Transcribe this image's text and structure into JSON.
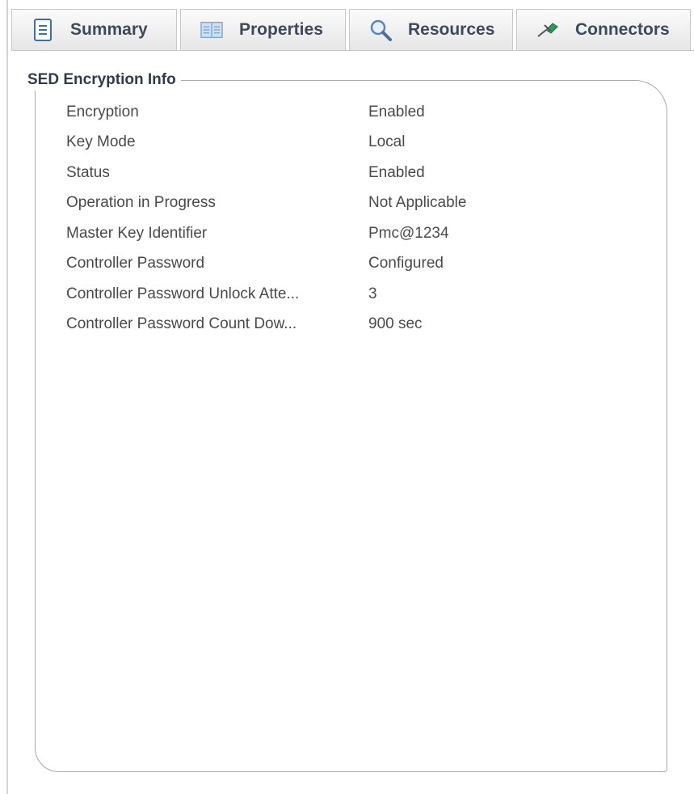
{
  "tabs": [
    {
      "label": "Summary",
      "icon": "document-icon"
    },
    {
      "label": "Properties",
      "icon": "properties-panel-icon"
    },
    {
      "label": "Resources",
      "icon": "magnifier-icon"
    },
    {
      "label": "Connectors",
      "icon": "connector-plug-icon"
    }
  ],
  "group": {
    "title": "SED Encryption Info"
  },
  "rows": [
    {
      "label": "Encryption",
      "value": "Enabled"
    },
    {
      "label": "Key Mode",
      "value": "Local"
    },
    {
      "label": "Status",
      "value": "Enabled"
    },
    {
      "label": "Operation in Progress",
      "value": "Not Applicable"
    },
    {
      "label": "Master Key Identifier",
      "value": "Pmc@1234"
    },
    {
      "label": "Controller Password",
      "value": "Configured"
    },
    {
      "label": "Controller Password Unlock Atte...",
      "value": "3"
    },
    {
      "label": "Controller Password Count Dow...",
      "value": "900 sec"
    }
  ],
  "colors": {
    "tab_text": "#3c4a5c",
    "border": "#a9a9a9",
    "text": "#4a4a4a"
  }
}
